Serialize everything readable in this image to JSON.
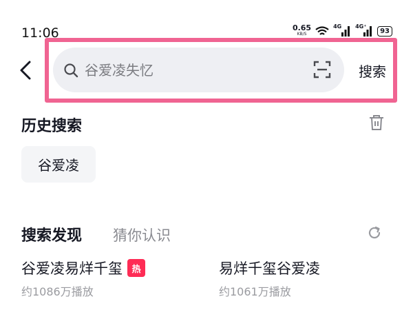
{
  "status_bar": {
    "time": "11:06",
    "net_speed_value": "0.65",
    "net_speed_unit": "KB/S",
    "signal1_label": "4G",
    "signal2_label": "4G⁺",
    "battery": "93",
    "icons": [
      "wifi-icon",
      "signal-icon",
      "signal-icon",
      "battery-icon"
    ]
  },
  "top_bar": {
    "back_icon": "chevron-left-icon",
    "search": {
      "icon": "search-icon",
      "placeholder": "谷爱凌失忆",
      "value": "",
      "scan_icon": "scan-icon"
    },
    "submit_label": "搜索",
    "highlight_color": "#f06492"
  },
  "history": {
    "title": "历史搜索",
    "clear_icon": "trash-icon",
    "items": [
      "谷爱凌"
    ]
  },
  "discover": {
    "title": "搜索发现",
    "subtab": "猜你认识",
    "refresh_icon": "refresh-icon",
    "items": [
      {
        "title": "谷爱凌易烊千玺",
        "badge": "热",
        "sub": "约1086万播放"
      },
      {
        "title": "易烊千玺谷爱凌",
        "sub": "约1061万播放"
      }
    ]
  },
  "colors": {
    "hot_badge": "#fe2c55",
    "search_bg": "#eeeff3",
    "chip_bg": "#f4f5f7"
  }
}
